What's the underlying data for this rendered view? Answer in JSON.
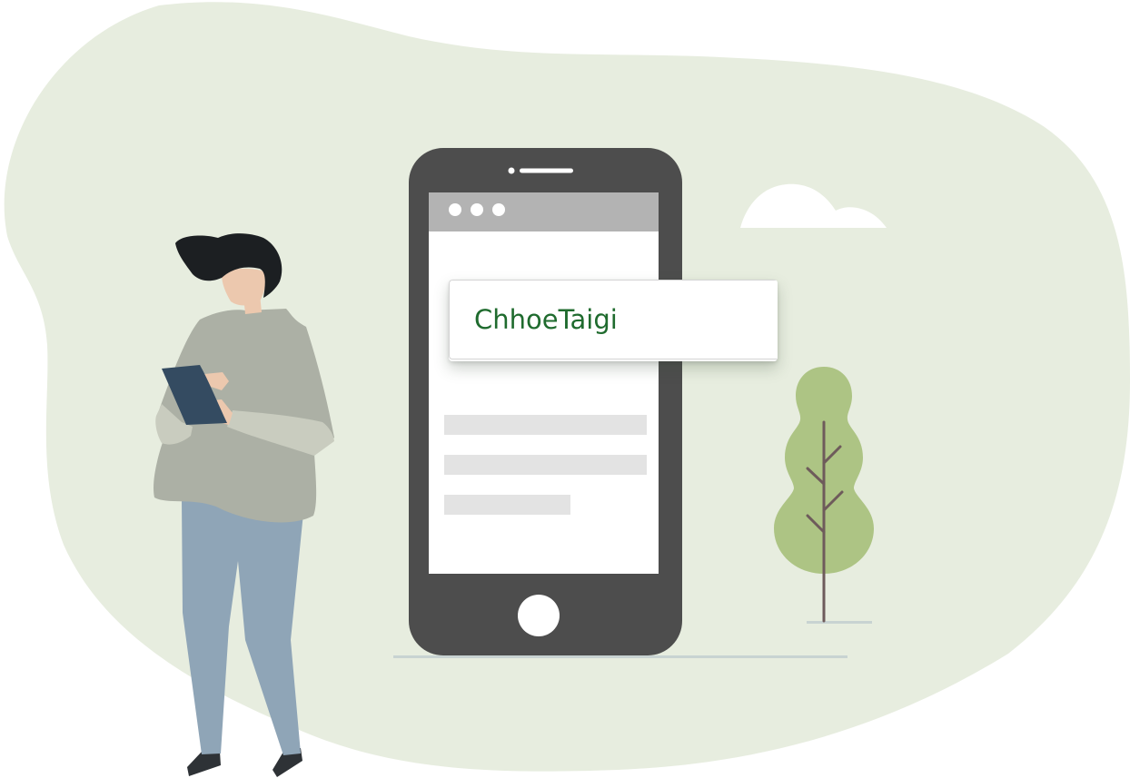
{
  "search": {
    "value": "ChhoeTaigi"
  },
  "icons": {
    "search_button": "search-icon"
  },
  "colors": {
    "blob_background": "#e7eddf",
    "phone_body": "#4d4d4d",
    "browser_bar": "#b3b3b3",
    "search_text": "#1f6b2e",
    "search_button": "#226630",
    "tree_foliage": "#adc484",
    "tree_trunk": "#6e5b5b",
    "shirt": "#acb0a5",
    "pants": "#8fa5b7",
    "tablet": "#344b61",
    "hair": "#1c1f22",
    "skin": "#ecc8ae"
  }
}
